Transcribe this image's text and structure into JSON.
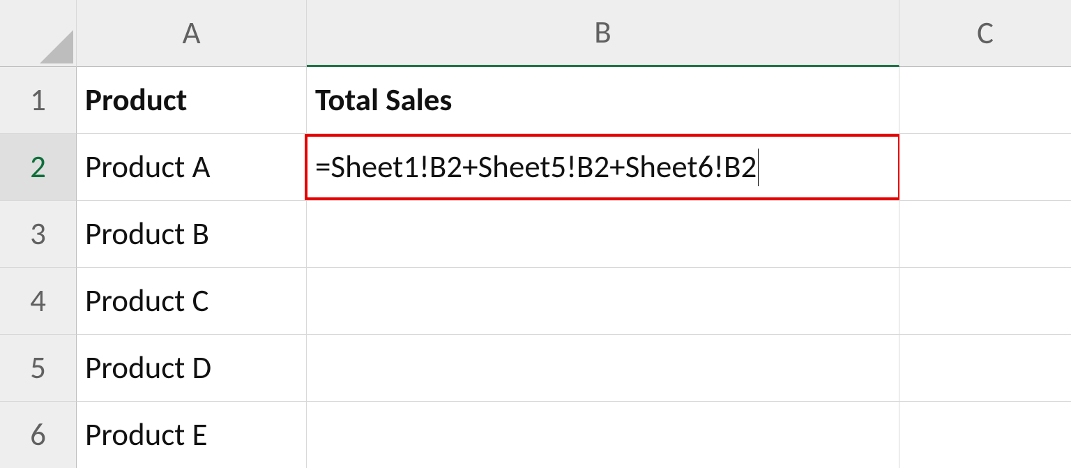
{
  "columns": {
    "A": "A",
    "B": "B",
    "C": "C"
  },
  "rows": {
    "r1": "1",
    "r2": "2",
    "r3": "3",
    "r4": "4",
    "r5": "5",
    "r6": "6"
  },
  "headers": {
    "A": "Product",
    "B": "Total Sales"
  },
  "data": {
    "A2": "Product A",
    "A3": "Product B",
    "A4": "Product C",
    "A5": "Product D",
    "A6": "Product E"
  },
  "editing_cell": {
    "address": "B2",
    "formula": "=Sheet1!B2+Sheet5!B2+Sheet6!B2"
  },
  "active": {
    "row": "2",
    "col": "B"
  },
  "chart_data": {
    "type": "table",
    "columns": [
      "Product",
      "Total Sales"
    ],
    "rows": [
      [
        "Product A",
        "=Sheet1!B2+Sheet5!B2+Sheet6!B2"
      ],
      [
        "Product B",
        ""
      ],
      [
        "Product C",
        ""
      ],
      [
        "Product D",
        ""
      ],
      [
        "Product E",
        ""
      ]
    ]
  }
}
